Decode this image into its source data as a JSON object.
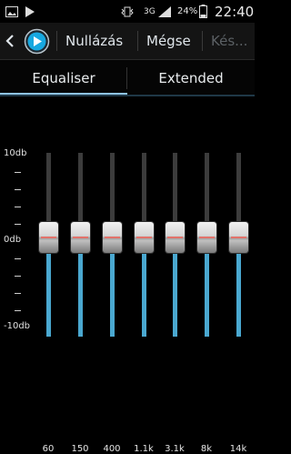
{
  "status_bar": {
    "network": "3G",
    "battery": "24%",
    "time": "22:40"
  },
  "action_bar": {
    "reset_label": "Nullázás",
    "cancel_label": "Mégse",
    "done_label": "Kés..."
  },
  "tabs": [
    {
      "label": "Equaliser",
      "selected": true
    },
    {
      "label": "Extended",
      "selected": false
    }
  ],
  "eq": {
    "db_labels": {
      "top": "10db",
      "mid": "0db",
      "bottom": "-10db"
    },
    "bands": [
      {
        "freq": "60",
        "gain_db": 0
      },
      {
        "freq": "150",
        "gain_db": 0
      },
      {
        "freq": "400",
        "gain_db": 0
      },
      {
        "freq": "1.1k",
        "gain_db": 0
      },
      {
        "freq": "3.1k",
        "gain_db": 0
      },
      {
        "freq": "8k",
        "gain_db": 0
      },
      {
        "freq": "14k",
        "gain_db": 0
      }
    ]
  },
  "colors": {
    "accent": "#8ec3e6",
    "slider_fill": "#4aa8d0",
    "knob_mark": "#e2726a"
  },
  "icons": [
    "image-icon",
    "play-icon",
    "vibrate-icon",
    "alarm-icon",
    "signal-icon",
    "battery-icon",
    "back-icon",
    "app-logo-icon"
  ]
}
